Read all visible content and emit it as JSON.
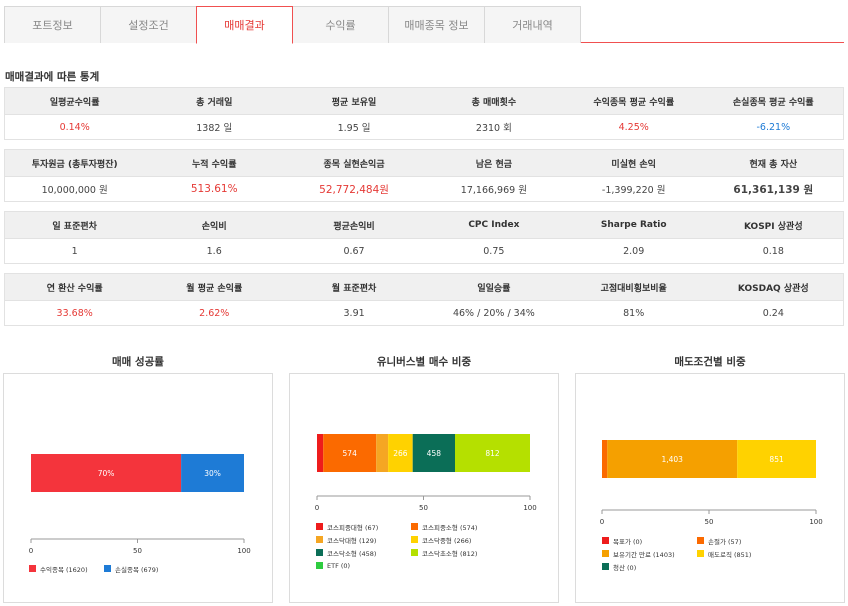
{
  "tabs": [
    "포트정보",
    "설정조건",
    "매매결과",
    "수익률",
    "매매종목 정보",
    "거래내역"
  ],
  "active_tab": 2,
  "section_title": "매매결과에 따른 통계",
  "stats": [
    {
      "headers": [
        "일평균수익률",
        "총 거래일",
        "평균 보유일",
        "총 매매횟수",
        "수익종목 평균 수익률",
        "손실종목 평균 수익률"
      ],
      "values": [
        "0.14%",
        "1382 일",
        "1.95 일",
        "2310 회",
        "4.25%",
        "-6.21%"
      ]
    },
    {
      "headers": [
        "투자원금 (총투자평잔)",
        "누적 수익률",
        "종목 실현손익금",
        "남은 현금",
        "미실현 손익",
        "현재 총 자산"
      ],
      "values": [
        "10,000,000 원",
        "513.61%",
        "52,772,484원",
        "17,166,969 원",
        "-1,399,220 원",
        "61,361,139 원"
      ]
    },
    {
      "headers": [
        "일 표준편차",
        "손익비",
        "평균손익비",
        "CPC Index",
        "Sharpe Ratio",
        "KOSPI 상관성"
      ],
      "values": [
        "1",
        "1.6",
        "0.67",
        "0.75",
        "2.09",
        "0.18"
      ]
    },
    {
      "headers": [
        "연 환산 수익률",
        "월 평균 손익률",
        "월 표준편차",
        "일일승률",
        "고점대비횡보비율",
        "KOSDAQ 상관성"
      ],
      "values": [
        "33.68%",
        "2.62%",
        "3.91",
        "46% / 20% / 34%",
        "81%",
        "0.24"
      ]
    }
  ],
  "colors": {
    "accent": "#e53935",
    "negative": "#1e7bd6"
  },
  "chart_data": [
    {
      "type": "bar",
      "stacked": "horizontal-100%",
      "title": "매매 성공률",
      "xlim": [
        0,
        100
      ],
      "ticks": [
        "0",
        "50",
        "100"
      ],
      "series": [
        {
          "name": "수익종목 (1620)",
          "values": [
            1620
          ],
          "label": "70%",
          "color": "#f4343c"
        },
        {
          "name": "손실종목 (679)",
          "values": [
            679
          ],
          "label": "30%",
          "color": "#1e7bd6"
        }
      ]
    },
    {
      "type": "bar",
      "stacked": "horizontal-100%",
      "title": "유니버스별 매수 비중",
      "xlim": [
        0,
        100
      ],
      "ticks": [
        "0",
        "50",
        "100"
      ],
      "series": [
        {
          "name": "코스피중대형 (67)",
          "values": [
            67
          ],
          "label": "",
          "color": "#ee1c1c"
        },
        {
          "name": "코스피중소형 (574)",
          "values": [
            574
          ],
          "label": "574",
          "color": "#fb6a00"
        },
        {
          "name": "코스닥대형 (129)",
          "values": [
            129
          ],
          "label": "",
          "color": "#f5a623"
        },
        {
          "name": "코스닥중형 (266)",
          "values": [
            266
          ],
          "label": "266",
          "color": "#ffd200"
        },
        {
          "name": "코스닥소형 (458)",
          "values": [
            458
          ],
          "label": "458",
          "color": "#0b6e57"
        },
        {
          "name": "코스닥초소형 (812)",
          "values": [
            812
          ],
          "label": "812",
          "color": "#b5e000"
        },
        {
          "name": "ETF (0)",
          "values": [
            0
          ],
          "label": "",
          "color": "#2ecc40"
        }
      ]
    },
    {
      "type": "bar",
      "stacked": "horizontal-100%",
      "title": "매도조건별 비중",
      "xlim": [
        0,
        100
      ],
      "ticks": [
        "0",
        "50",
        "100"
      ],
      "series": [
        {
          "name": "목표가 (0)",
          "values": [
            0
          ],
          "label": "",
          "color": "#ee1c1c"
        },
        {
          "name": "손절가 (57)",
          "values": [
            57
          ],
          "label": "",
          "color": "#fb6a00"
        },
        {
          "name": "보유기간 만료 (1403)",
          "values": [
            1403
          ],
          "label": "1,403",
          "color": "#f5a000"
        },
        {
          "name": "매도로직 (851)",
          "values": [
            851
          ],
          "label": "851",
          "color": "#ffd200"
        },
        {
          "name": "청산 (0)",
          "values": [
            0
          ],
          "label": "",
          "color": "#0b6e57"
        }
      ]
    }
  ]
}
